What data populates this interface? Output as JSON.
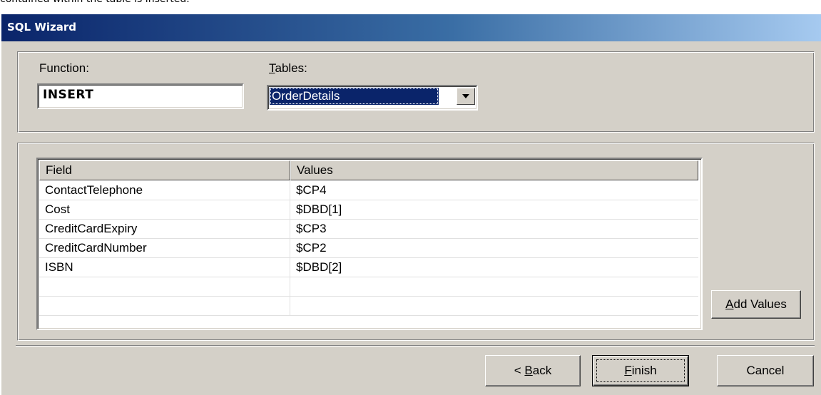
{
  "caption": "contained within the table is inserted.",
  "window": {
    "title": "SQL Wizard"
  },
  "query": {
    "function_label": "Function:",
    "function_value": "INSERT",
    "tables_label_mnemonic": "T",
    "tables_label_rest": "ables:",
    "tables_selected": "OrderDetails"
  },
  "grid": {
    "columns": [
      "Field",
      "Values"
    ],
    "rows": [
      {
        "field": "ContactTelephone",
        "value": "$CP4"
      },
      {
        "field": "Cost",
        "value": "$DBD[1]"
      },
      {
        "field": "CreditCardExpiry",
        "value": "$CP3"
      },
      {
        "field": "CreditCardNumber",
        "value": "$CP2"
      },
      {
        "field": "ISBN",
        "value": "$DBD[2]"
      },
      {
        "field": "",
        "value": ""
      },
      {
        "field": "",
        "value": ""
      }
    ]
  },
  "buttons": {
    "add_values_mnemonic": "A",
    "add_values_rest": "dd Values",
    "back_prefix": "< ",
    "back_mnemonic": "B",
    "back_rest": "ack",
    "finish_mnemonic": "F",
    "finish_rest": "inish",
    "cancel": "Cancel"
  },
  "colors": {
    "dialog_face": "#d4d0c8",
    "title_gradient_start": "#0a246a",
    "title_gradient_end": "#a6caf0",
    "selection": "#0a246a"
  }
}
